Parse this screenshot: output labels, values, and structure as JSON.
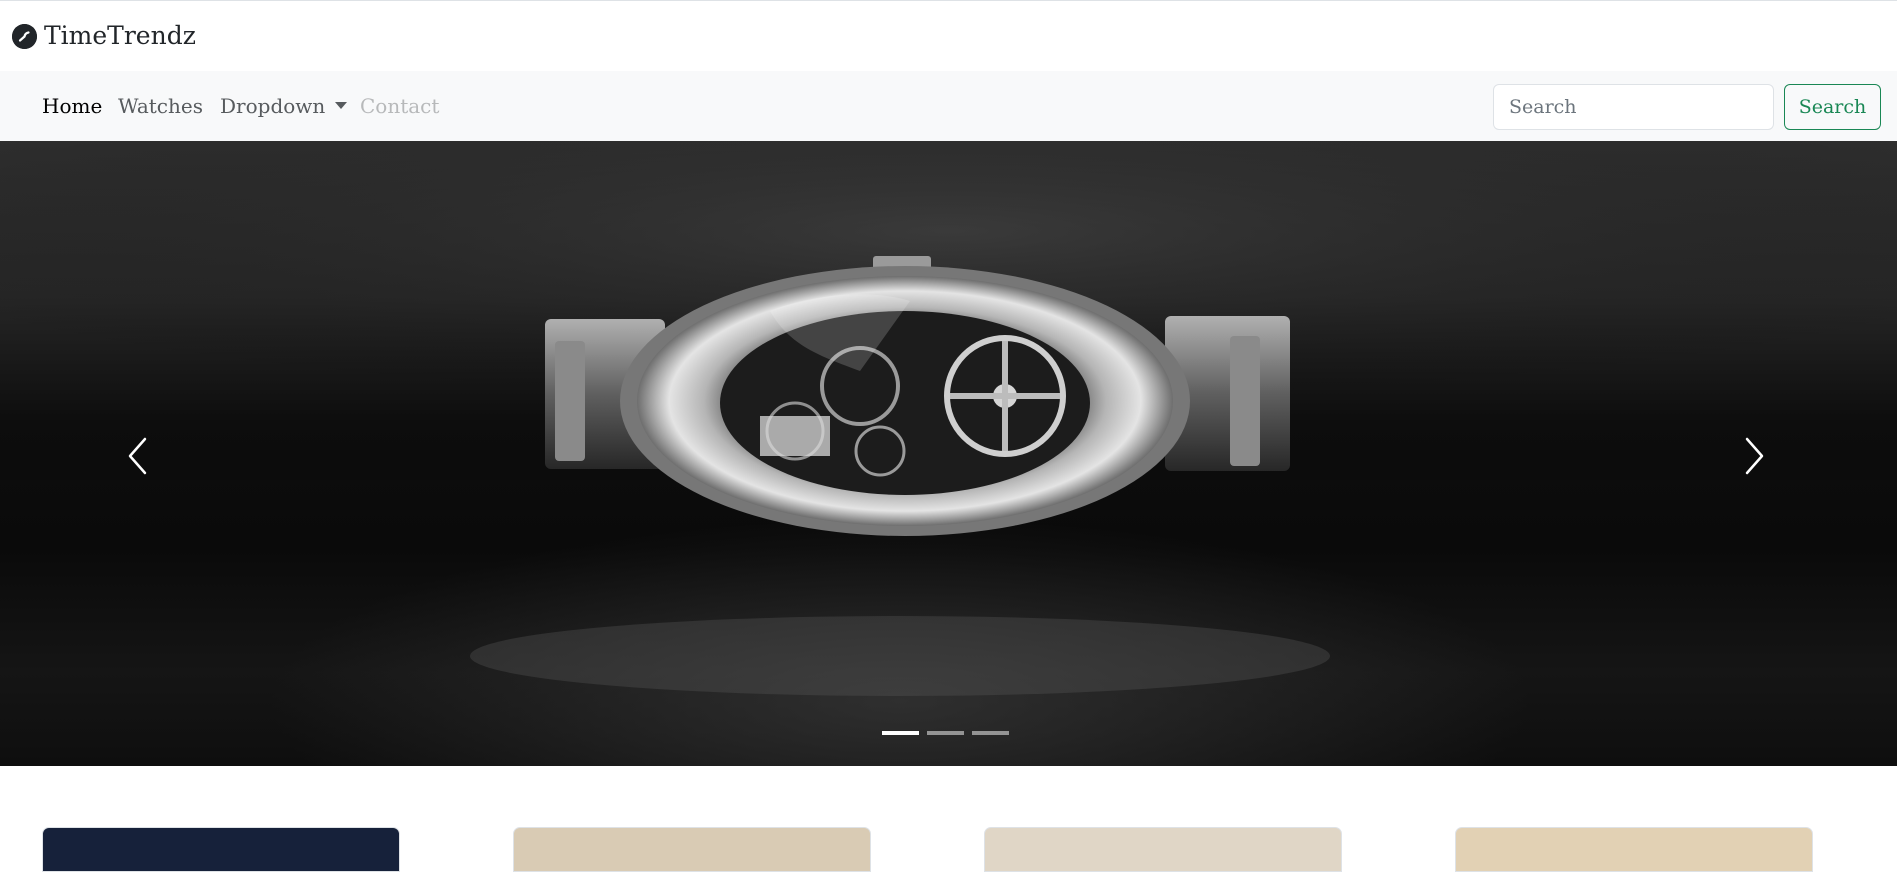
{
  "brand": {
    "name": "TimeTrendz",
    "logo_icon": "clock-logo-icon"
  },
  "nav": {
    "items": [
      {
        "label": "Home",
        "state": "active"
      },
      {
        "label": "Watches",
        "state": "default"
      },
      {
        "label": "Dropdown",
        "state": "default",
        "has_caret": true
      },
      {
        "label": "Contact",
        "state": "disabled"
      }
    ]
  },
  "search": {
    "placeholder": "Search",
    "value": "",
    "button_label": "Search"
  },
  "carousel": {
    "slide_count": 3,
    "active_slide": 1,
    "prev_icon": "chevron-left-icon",
    "next_icon": "chevron-right-icon"
  },
  "cards": {
    "count": 4,
    "thumb_colors": [
      "#16213a",
      "#d9cbb4",
      "#e0d6c6",
      "#e2d1b4"
    ]
  },
  "colors": {
    "accent": "#198754",
    "nav_background": "#f8f9fa",
    "text_dark": "#212529"
  }
}
